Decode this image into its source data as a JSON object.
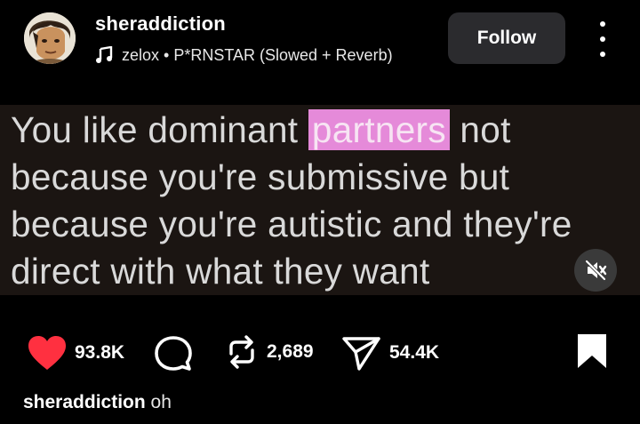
{
  "post": {
    "username": "sheraddiction",
    "audio": "zelox • P*RNSTAR (Slowed + Reverb)",
    "follow_label": "Follow"
  },
  "media": {
    "text_before": "You like dominant ",
    "text_highlight": "partners",
    "text_after": " not because you're submissive but because you're autistic and they're direct with what they want",
    "highlight_color": "#e58ad9",
    "muted": true
  },
  "actions": {
    "likes": "93.8K",
    "reposts": "2,689",
    "shares": "54.4K",
    "like_color": "#ff3040"
  },
  "caption": {
    "username": "sheraddiction",
    "text": "oh"
  }
}
